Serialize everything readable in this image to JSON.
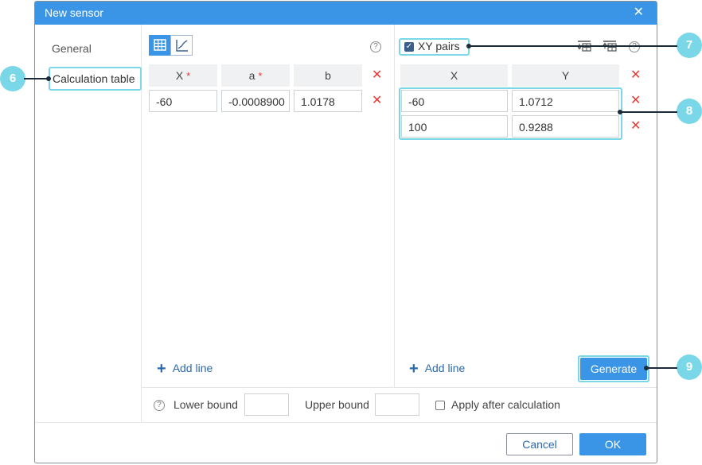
{
  "dialog": {
    "title": "New sensor",
    "close_symbol": "✕"
  },
  "sidebar": {
    "items": [
      {
        "label": "General"
      },
      {
        "label": "Calculation table"
      }
    ]
  },
  "left_table": {
    "headers": [
      {
        "label": "X",
        "required": "*"
      },
      {
        "label": "a",
        "required": "*"
      },
      {
        "label": "b"
      }
    ],
    "rows": [
      {
        "x": "-60",
        "a": "-0.0008900",
        "b": "1.0178"
      }
    ],
    "add_line": "Add line",
    "help_icon": "?"
  },
  "right_table": {
    "xy_pairs_label": "XY pairs",
    "xy_pairs_checked": true,
    "headers": [
      {
        "label": "X"
      },
      {
        "label": "Y"
      }
    ],
    "rows": [
      {
        "x": "-60",
        "y": "1.0712"
      },
      {
        "x": "100",
        "y": "0.9288"
      }
    ],
    "add_line": "Add line",
    "generate": "Generate",
    "help_icon": "?"
  },
  "bounds": {
    "lower_label": "Lower bound",
    "upper_label": "Upper bound",
    "lower_value": "",
    "upper_value": "",
    "apply_label": "Apply after calculation",
    "help_icon": "?"
  },
  "footer": {
    "cancel": "Cancel",
    "ok": "OK"
  },
  "callouts": [
    "6",
    "7",
    "8",
    "9"
  ],
  "colors": {
    "accent": "#3a95e6",
    "highlight": "#79d7e8",
    "delete": "#e53935",
    "link": "#2b69ad"
  }
}
